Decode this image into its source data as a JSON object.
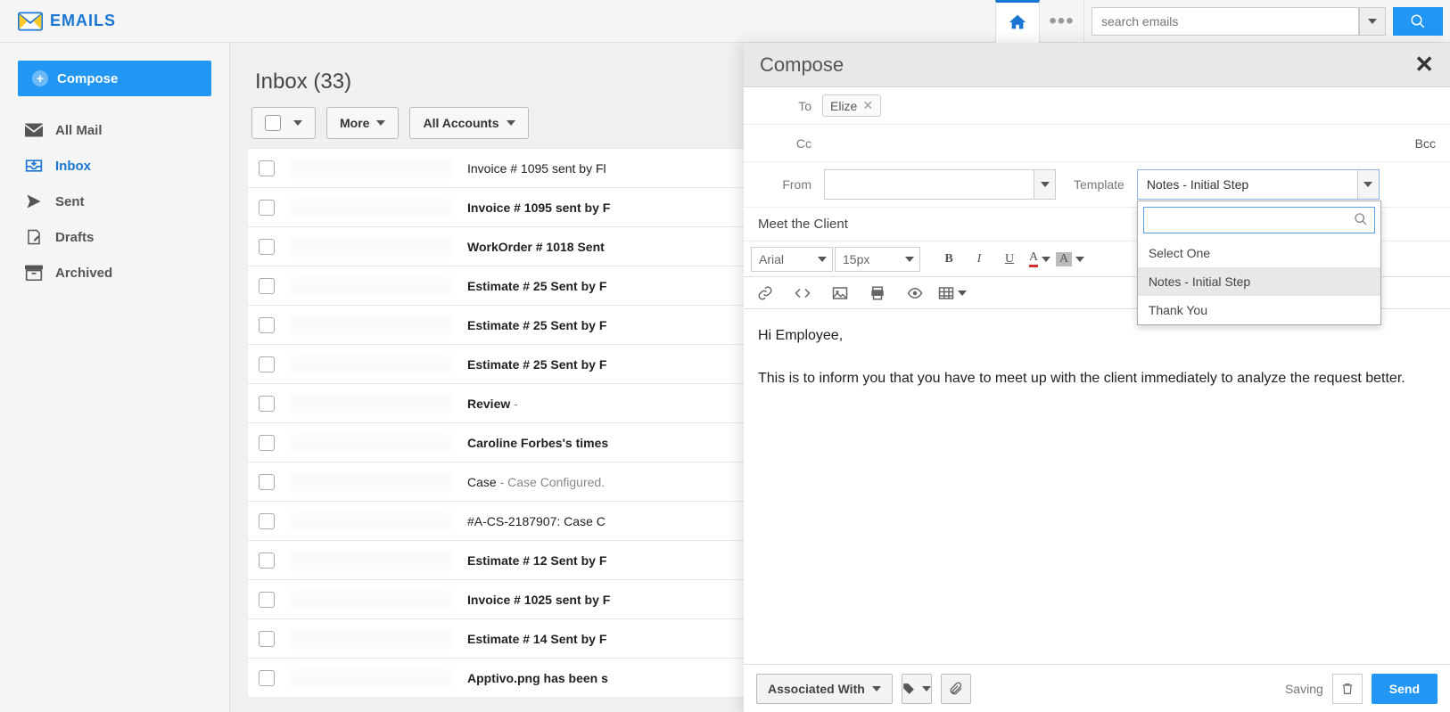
{
  "app": {
    "name": "EMAILS"
  },
  "search": {
    "placeholder": "search emails"
  },
  "sidebar": {
    "compose": "Compose",
    "items": [
      {
        "label": "All Mail"
      },
      {
        "label": "Inbox"
      },
      {
        "label": "Sent"
      },
      {
        "label": "Drafts"
      },
      {
        "label": "Archived"
      }
    ]
  },
  "list": {
    "title": "Inbox (33)",
    "more": "More",
    "accounts": "All Accounts",
    "rows": [
      {
        "subject": "Invoice # 1095 sent by Fl",
        "bold": false,
        "extra": ""
      },
      {
        "subject": "Invoice # 1095 sent by F",
        "bold": true,
        "extra": ""
      },
      {
        "subject": "WorkOrder # 1018 Sent",
        "bold": true,
        "extra": ""
      },
      {
        "subject": "Estimate # 25 Sent by F",
        "bold": true,
        "extra": ""
      },
      {
        "subject": "Estimate # 25 Sent by F",
        "bold": true,
        "extra": ""
      },
      {
        "subject": "Estimate # 25 Sent by F",
        "bold": true,
        "extra": ""
      },
      {
        "subject": "Review",
        "bold": true,
        "extra": " -"
      },
      {
        "subject": "Caroline Forbes's times",
        "bold": true,
        "extra": ""
      },
      {
        "subject": "Case",
        "bold": false,
        "extra": " - Case Configured."
      },
      {
        "subject": "#A-CS-2187907: Case C",
        "bold": false,
        "extra": ""
      },
      {
        "subject": "Estimate # 12 Sent by F",
        "bold": true,
        "extra": ""
      },
      {
        "subject": "Invoice # 1025 sent by F",
        "bold": true,
        "extra": ""
      },
      {
        "subject": "Estimate # 14 Sent by F",
        "bold": true,
        "extra": ""
      },
      {
        "subject": "Apptivo.png has been s",
        "bold": true,
        "extra": ""
      }
    ]
  },
  "compose": {
    "title": "Compose",
    "to_label": "To",
    "to_chip": "Elize",
    "cc_label": "Cc",
    "bcc_label": "Bcc",
    "from_label": "From",
    "template_label": "Template",
    "template_value": "Notes - Initial Step",
    "template_options": {
      "select_one": "Select One",
      "opt1": "Notes - Initial Step",
      "opt2": "Thank You"
    },
    "subject": "Meet the Client",
    "font": "Arial",
    "size": "15px",
    "body_line1": "Hi Employee,",
    "body_line2": "This is to inform you that you have to meet up with the client immediately to analyze the request better.",
    "footer": {
      "associated": "Associated With",
      "saving": "Saving",
      "send": "Send"
    }
  }
}
